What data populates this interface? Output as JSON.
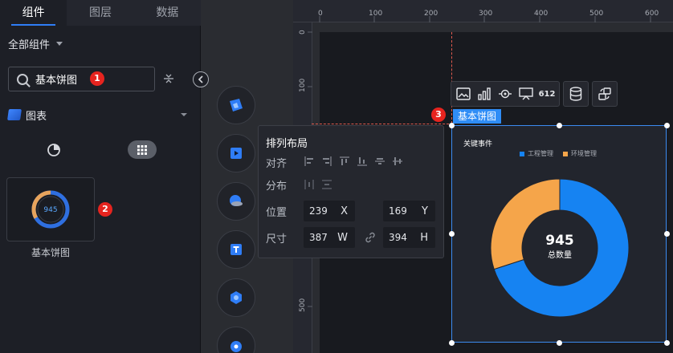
{
  "left_panel": {
    "tabs": [
      {
        "label": "组件",
        "active": true
      },
      {
        "label": "图层",
        "active": false
      },
      {
        "label": "数据",
        "active": false
      }
    ],
    "all_components_label": "全部组件",
    "search": {
      "value": "基本饼图",
      "badge": "1"
    },
    "category": {
      "label": "图表",
      "icon": "chart-category-icon"
    },
    "view_toggles": [
      "pie-view-icon",
      "grid-view-icon"
    ],
    "component": {
      "label": "基本饼图",
      "thumbnail_value": "945",
      "badge": "2"
    }
  },
  "rail_icons": [
    "chart-3d-icon",
    "media-icon",
    "map-globe-icon",
    "text-icon",
    "tech-icon",
    "interaction-icon"
  ],
  "ruler": {
    "top_labels": [
      "0",
      "100",
      "200",
      "300",
      "400",
      "500",
      "600"
    ],
    "left_labels": [
      "0",
      "100",
      "500"
    ]
  },
  "toolbar": {
    "icons": [
      "image-icon",
      "bar-chart-icon",
      "target-icon",
      "screen-icon",
      "number-icon",
      "database-icon",
      "swap-icon"
    ],
    "number_label": "612"
  },
  "selection": {
    "label": "基本饼图",
    "badge": "3"
  },
  "arrange_panel": {
    "title": "排列布局",
    "align_label": "对齐",
    "distribute_label": "分布",
    "position_label": "位置",
    "size_label": "尺寸",
    "x_value": "239",
    "x_unit": "X",
    "y_value": "169",
    "y_unit": "Y",
    "w_value": "387",
    "w_unit": "W",
    "h_value": "394",
    "h_unit": "H"
  },
  "chart_widget": {
    "title": "关键事件",
    "center_value": "945",
    "center_label": "总数量"
  },
  "chart_data": {
    "type": "pie",
    "title": "关键事件",
    "categories": [
      "工程管理",
      "环境管理"
    ],
    "values": [
      70,
      30
    ],
    "colors": [
      "#1683f2",
      "#f5a54a"
    ],
    "donut": true,
    "center_value": 945,
    "center_label": "总数量",
    "legend_position": "top"
  }
}
